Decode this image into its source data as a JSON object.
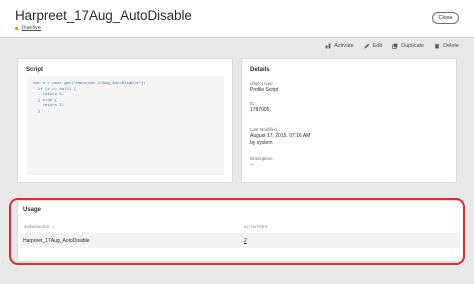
{
  "header": {
    "title": "Harpreet_17Aug_AutoDisable",
    "status": "Inactive",
    "close_label": "Close"
  },
  "toolbar": {
    "actions": [
      {
        "label": "Activate",
        "icon": "activate-icon"
      },
      {
        "label": "Edit",
        "icon": "pencil-icon"
      },
      {
        "label": "Duplicate",
        "icon": "duplicate-icon"
      },
      {
        "label": "Delete",
        "icon": "trash-icon"
      }
    ]
  },
  "script": {
    "title": "Script",
    "code": "var x = user.get(\"Harpreet_17Aug_AutoDisable\");\n  if (x == null) {\n    return 1;\n  } else {\n    return 2;\n  }"
  },
  "details": {
    "title": "Details",
    "fields": [
      {
        "label": "Object type",
        "value": "Profile Script"
      },
      {
        "label": "ID",
        "value": "1787005"
      },
      {
        "label": "Last Modified",
        "value": "August 17, 2015, 07:16 AM",
        "sub": "by system"
      },
      {
        "label": "Description",
        "value": "--"
      }
    ]
  },
  "usage": {
    "title": "Usage",
    "columns": [
      "AUDIENCES",
      "ACTIVITIES"
    ],
    "sort_indicator": "↓",
    "rows": [
      {
        "audience": "Harpreet_17Aug_AutoDisable",
        "activities": "2"
      }
    ]
  },
  "colors": {
    "status_dot": "#e68619",
    "highlight": "#e02b2b",
    "code_text": "#3a6ea5"
  }
}
